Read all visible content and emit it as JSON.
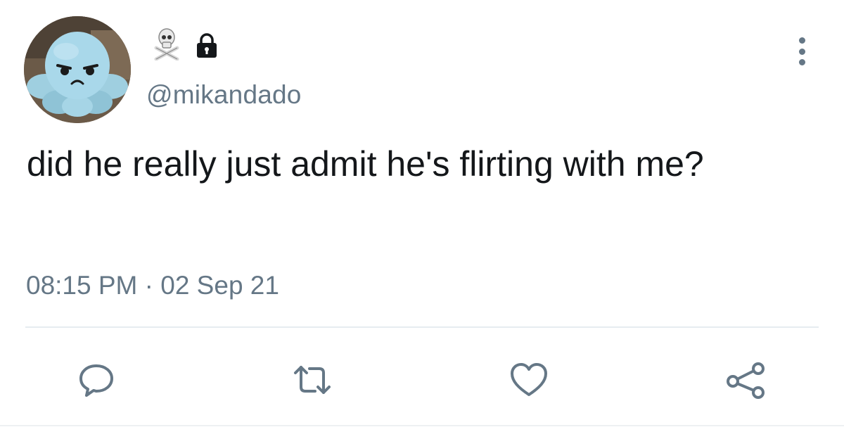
{
  "tweet": {
    "handle": "@mikandado",
    "text": "did he really just admit he's flirting with me?",
    "timestamp": "08:15 PM · 02 Sep 21"
  },
  "icons": {
    "name_glyph": "skull-and-crossbones-icon",
    "protected": "lock-icon",
    "more": "more-options-icon",
    "reply": "reply-icon",
    "retweet": "retweet-icon",
    "like": "heart-icon",
    "share": "share-icon"
  },
  "colors": {
    "text": "#14171a",
    "secondary": "#657786",
    "divider": "#e6ecf0"
  }
}
